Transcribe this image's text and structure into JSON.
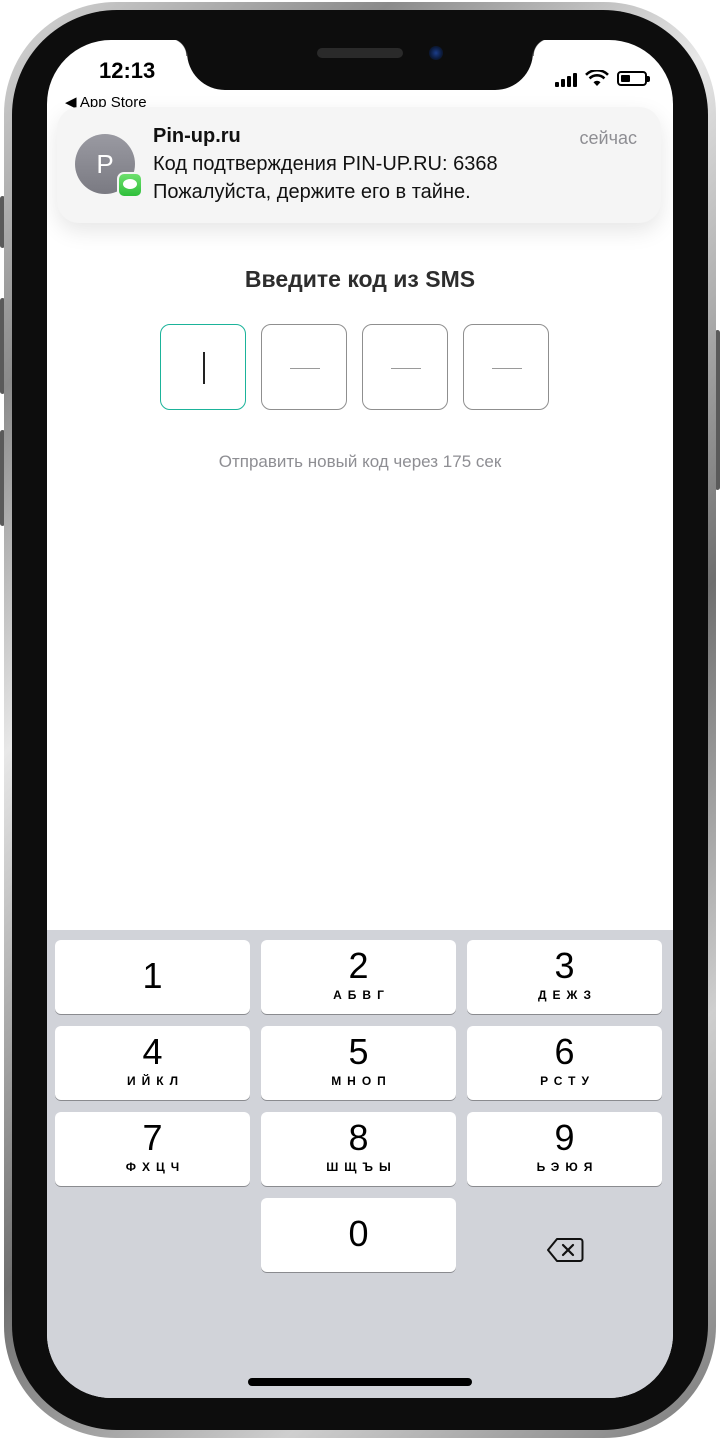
{
  "status_bar": {
    "time": "12:13",
    "back_app": "◀ App Store"
  },
  "notification": {
    "avatar_letter": "P",
    "sender": "Pin-up.ru",
    "time": "сейчас",
    "line1": "Код подтверждения PIN-UP.RU: 6368",
    "line2": "Пожалуйста, держите его в тайне."
  },
  "page": {
    "heading": "Введите код из SMS",
    "resend_text": "Отправить новый код через 175 сек"
  },
  "keypad": {
    "keys": [
      {
        "num": "1",
        "letters": ""
      },
      {
        "num": "2",
        "letters": "АБВГ"
      },
      {
        "num": "3",
        "letters": "ДЕЖЗ"
      },
      {
        "num": "4",
        "letters": "ИЙКЛ"
      },
      {
        "num": "5",
        "letters": "МНОП"
      },
      {
        "num": "6",
        "letters": "РСТУ"
      },
      {
        "num": "7",
        "letters": "ФХЦЧ"
      },
      {
        "num": "8",
        "letters": "ШЩЪЫ"
      },
      {
        "num": "9",
        "letters": "ЬЭЮЯ"
      },
      {
        "num": "0",
        "letters": ""
      }
    ]
  },
  "colors": {
    "accent": "#1bb39a",
    "keyboard_bg": "#d1d3d9",
    "hint_text": "#8e8e93"
  },
  "icons": {
    "backspace": "delete-left-icon",
    "messages": "messages-app-icon"
  }
}
